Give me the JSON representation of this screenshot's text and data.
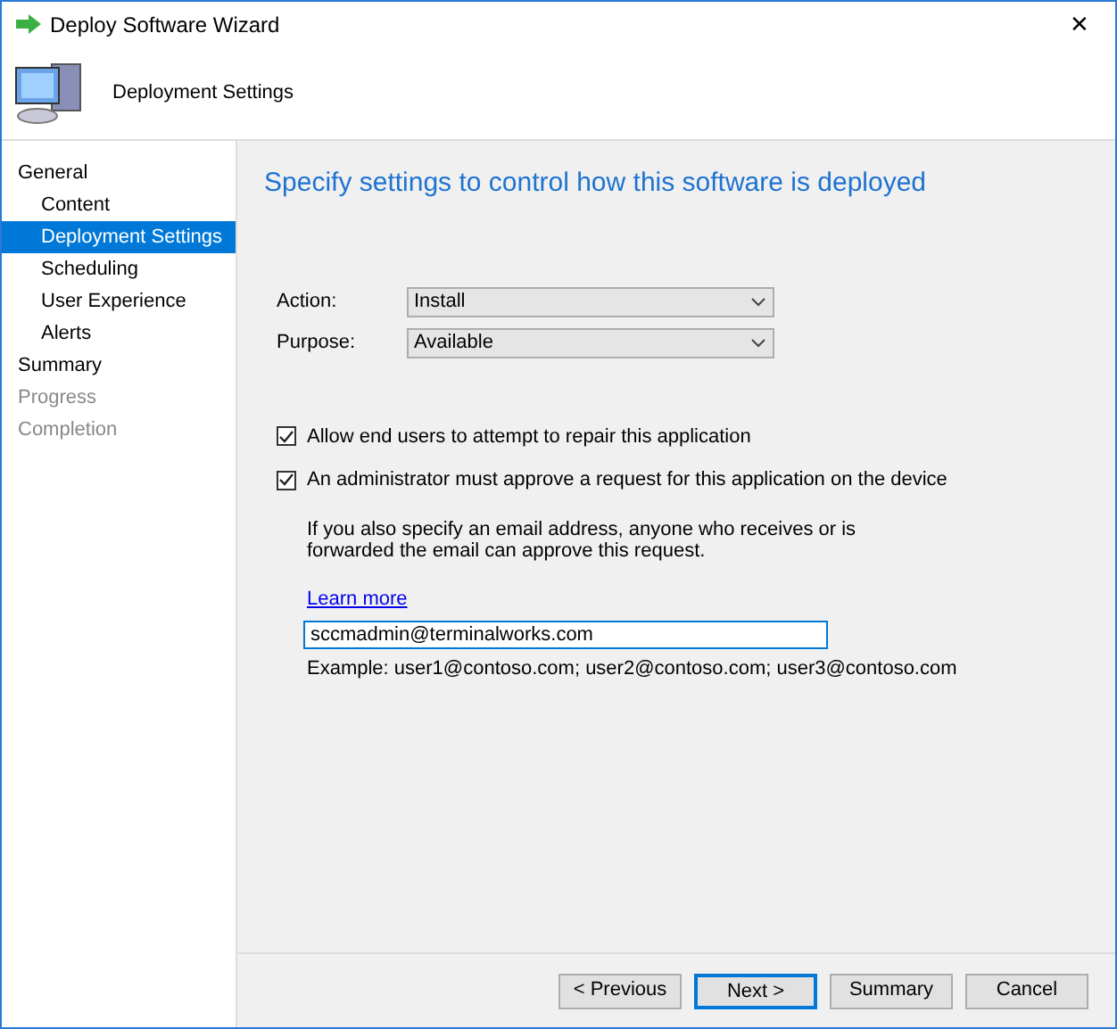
{
  "window": {
    "title": "Deploy Software Wizard",
    "close": "✕"
  },
  "header": {
    "title": "Deployment Settings"
  },
  "sidebar": {
    "items": [
      {
        "label": "General",
        "selected": false,
        "disabled": false,
        "children": [
          {
            "label": "Content",
            "selected": false,
            "disabled": false
          },
          {
            "label": "Deployment Settings",
            "selected": true,
            "disabled": false
          },
          {
            "label": "Scheduling",
            "selected": false,
            "disabled": false
          },
          {
            "label": "User Experience",
            "selected": false,
            "disabled": false
          },
          {
            "label": "Alerts",
            "selected": false,
            "disabled": false
          }
        ]
      },
      {
        "label": "Summary",
        "selected": false,
        "disabled": false
      },
      {
        "label": "Progress",
        "selected": false,
        "disabled": true
      },
      {
        "label": "Completion",
        "selected": false,
        "disabled": true
      }
    ]
  },
  "main": {
    "heading": "Specify settings to control how this software is deployed",
    "fields": [
      {
        "label": "Action:",
        "value": "Install"
      },
      {
        "label": "Purpose:",
        "value": "Available"
      }
    ],
    "checkboxes": [
      {
        "label": "Allow end users to attempt to repair this application",
        "checked": true
      },
      {
        "label": "An administrator must approve a request for this application on the device",
        "checked": true
      }
    ],
    "note": "If you also specify an email address, anyone who receives or is forwarded the email can approve this request.",
    "link": "Learn more",
    "email": {
      "value": "sccmadmin@terminalworks.com"
    },
    "example": "Example: user1@contoso.com; user2@contoso.com; user3@contoso.com"
  },
  "buttons": [
    {
      "label": "< Previous",
      "default": false
    },
    {
      "label": "Next >",
      "default": true
    },
    {
      "label": "Summary",
      "default": false
    },
    {
      "label": "Cancel",
      "default": false
    }
  ]
}
